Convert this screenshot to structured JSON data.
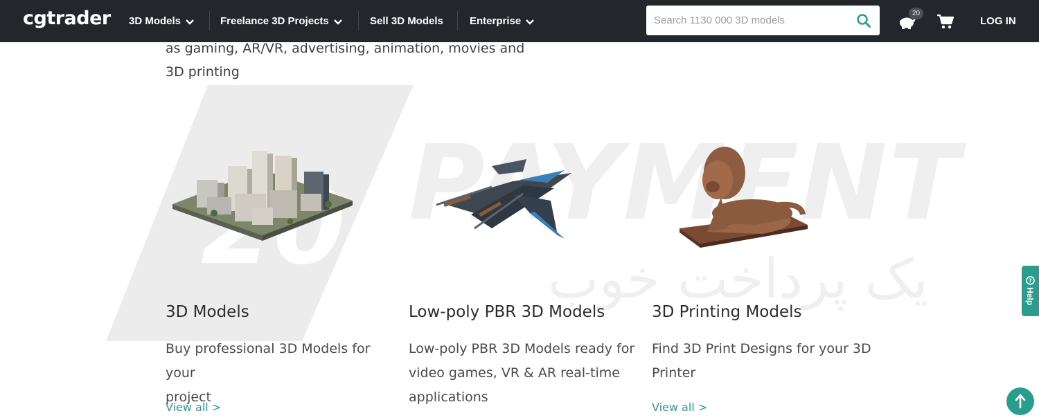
{
  "header": {
    "logo": "cgtrader",
    "nav": [
      {
        "label": "3D Models",
        "has_dropdown": true,
        "icon": "chevron-down-icon"
      },
      {
        "label": "Freelance 3D Projects",
        "has_dropdown": true,
        "icon": "chevron-down-icon"
      },
      {
        "label": "Sell 3D Models",
        "has_dropdown": false
      },
      {
        "label": "Enterprise",
        "has_dropdown": true,
        "icon": "chevron-down-icon"
      }
    ],
    "search": {
      "placeholder": "Search 1130 000 3D models",
      "value": "",
      "icon": "search-icon"
    },
    "piggy_bank": {
      "icon": "piggy-bank-icon",
      "badge": "20"
    },
    "cart": {
      "icon": "cart-icon"
    },
    "login": "LOG IN"
  },
  "intro": {
    "line1": "as gaming, AR/VR, advertising, animation, movies and",
    "line2": "3D printing"
  },
  "categories": [
    {
      "title": "3D Models",
      "desc_line1": "Buy professional 3D Models for your",
      "desc_line2": "project",
      "desc_line3": "",
      "link": "View all >",
      "image": "city-model-image"
    },
    {
      "title": "Low-poly PBR 3D Models",
      "desc_line1": "Low-poly PBR 3D Models ready for",
      "desc_line2": "video games, VR & AR real-time",
      "desc_line3": "applications",
      "link": "",
      "image": "spaceship-model-image"
    },
    {
      "title": "3D Printing Models",
      "desc_line1": "Find 3D Print Designs for your 3D",
      "desc_line2": "Printer",
      "desc_line3": "",
      "link": "View all >",
      "image": "lion-statue-image"
    }
  ],
  "watermark": {
    "word": "PAYMENT",
    "number": "20",
    "persian": "یک پرداخت خوب"
  },
  "help": {
    "label": "Help",
    "icon": "question-icon"
  },
  "scroll_top": {
    "icon": "arrow-up-icon"
  },
  "colors": {
    "topbar": "#23272b",
    "accent": "#2a9d8f",
    "watermark": "#ededed"
  }
}
